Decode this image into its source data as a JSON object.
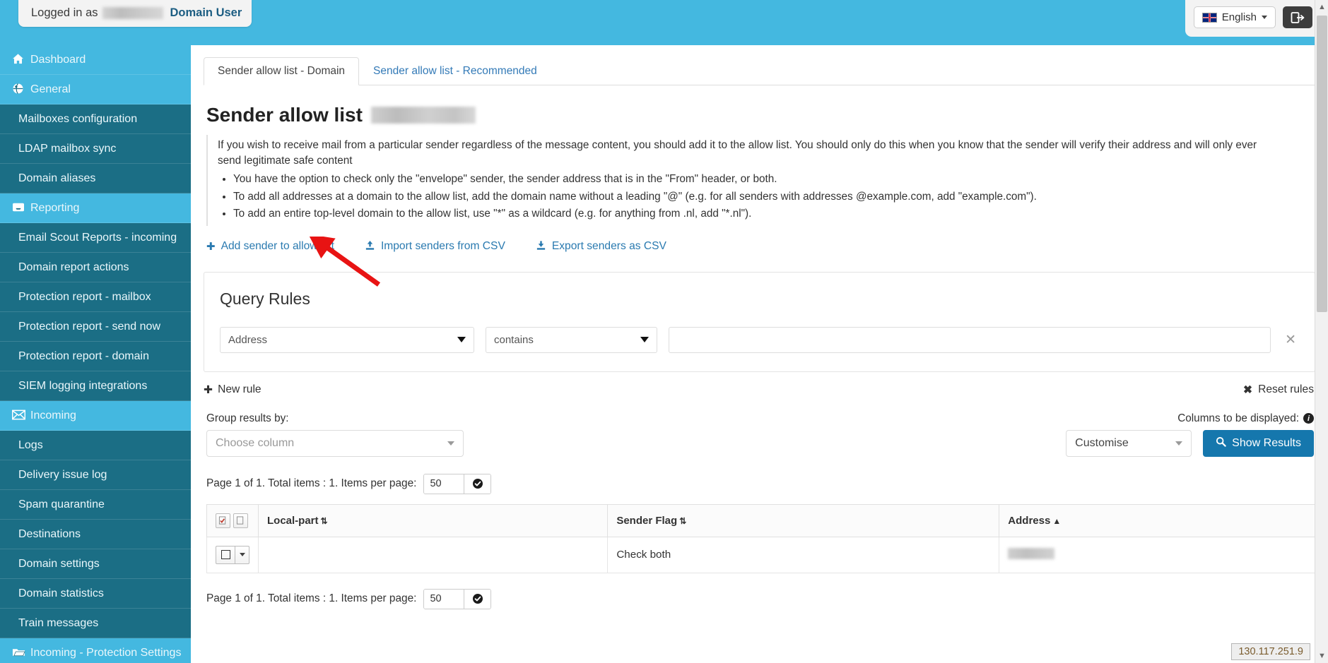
{
  "topbar": {
    "logged_in_label": "Logged in as",
    "logged_in_user": "[redacted]",
    "role": "Domain User",
    "language": "English",
    "logout_title": "Log out"
  },
  "sidebar": {
    "items": [
      {
        "label": "Dashboard",
        "icon": "home-icon",
        "type": "group"
      },
      {
        "label": "General",
        "icon": "globe-icon",
        "type": "group"
      },
      {
        "label": "Mailboxes configuration",
        "icon": "",
        "type": "sub"
      },
      {
        "label": "LDAP mailbox sync",
        "icon": "",
        "type": "sub"
      },
      {
        "label": "Domain aliases",
        "icon": "",
        "type": "sub"
      },
      {
        "label": "Reporting",
        "icon": "inbox-icon",
        "type": "group"
      },
      {
        "label": "Email Scout Reports - incoming",
        "icon": "",
        "type": "sub"
      },
      {
        "label": "Domain report actions",
        "icon": "",
        "type": "sub"
      },
      {
        "label": "Protection report - mailbox",
        "icon": "",
        "type": "sub"
      },
      {
        "label": "Protection report - send now",
        "icon": "",
        "type": "sub"
      },
      {
        "label": "Protection report - domain",
        "icon": "",
        "type": "sub"
      },
      {
        "label": "SIEM logging integrations",
        "icon": "",
        "type": "sub"
      },
      {
        "label": "Incoming",
        "icon": "envelope-icon",
        "type": "group"
      },
      {
        "label": "Logs",
        "icon": "",
        "type": "sub"
      },
      {
        "label": "Delivery issue log",
        "icon": "",
        "type": "sub"
      },
      {
        "label": "Spam quarantine",
        "icon": "",
        "type": "sub"
      },
      {
        "label": "Destinations",
        "icon": "",
        "type": "sub"
      },
      {
        "label": "Domain settings",
        "icon": "",
        "type": "sub"
      },
      {
        "label": "Domain statistics",
        "icon": "",
        "type": "sub"
      },
      {
        "label": "Train messages",
        "icon": "",
        "type": "sub"
      },
      {
        "label": "Incoming - Protection Settings",
        "icon": "folder-icon",
        "type": "group"
      }
    ]
  },
  "tabs": [
    {
      "label": "Sender allow list - Domain",
      "active": true
    },
    {
      "label": "Sender allow list - Recommended",
      "active": false
    }
  ],
  "page": {
    "title": "Sender allow list",
    "title_domain": "[redacted]",
    "help_paragraph": "If you wish to receive mail from a particular sender regardless of the message content, you should add it to the allow list. You should only do this when you know that the sender will verify their address and will only ever send legitimate safe content",
    "help_bullets": [
      "You have the option to check only the \"envelope\" sender, the sender address that is in the \"From\" header, or both.",
      "To add all addresses at a domain to the allow list, add the domain name without a leading \"@\" (e.g. for all senders with addresses @example.com, add \"example.com\").",
      "To add an entire top-level domain to the allow list, use \"*\" as a wildcard (e.g. for anything from .nl, add \"*.nl\")."
    ]
  },
  "actions": [
    {
      "label": "Add sender to allow list",
      "icon": "plus-icon"
    },
    {
      "label": "Import senders from CSV",
      "icon": "upload-icon"
    },
    {
      "label": "Export senders as CSV",
      "icon": "download-icon"
    }
  ],
  "query_rules": {
    "heading": "Query Rules",
    "rows": [
      {
        "field": "Address",
        "operator": "contains",
        "value": "",
        "value_placeholder": ""
      }
    ],
    "new_rule_label": "New rule",
    "reset_rules_label": "Reset rules",
    "delete_icon": "close-icon"
  },
  "controls": {
    "group_label": "Group results by:",
    "group_value": "Choose column",
    "columns_label": "Columns to be displayed:",
    "columns_value": "Customise",
    "show_results_label": "Show Results"
  },
  "pagination": {
    "summary": "Page 1 of 1. Total items : 1. Items per page:",
    "items_per_page": "50"
  },
  "table": {
    "columns": [
      {
        "label": "",
        "sort": ""
      },
      {
        "label": "Local-part",
        "sort": "both"
      },
      {
        "label": "Sender Flag",
        "sort": "both"
      },
      {
        "label": "Address",
        "sort": "asc"
      }
    ],
    "rows": [
      {
        "local_part": "",
        "sender_flag": "Check both",
        "address": "[redacted]"
      }
    ]
  },
  "footer": {
    "ip": "130.117.251.9"
  },
  "colors": {
    "brand_light": "#44b8e0",
    "brand_dark": "#1b6e85",
    "link": "#337ab7",
    "primary_button": "#1577ad",
    "annotation_arrow": "#e81313"
  }
}
